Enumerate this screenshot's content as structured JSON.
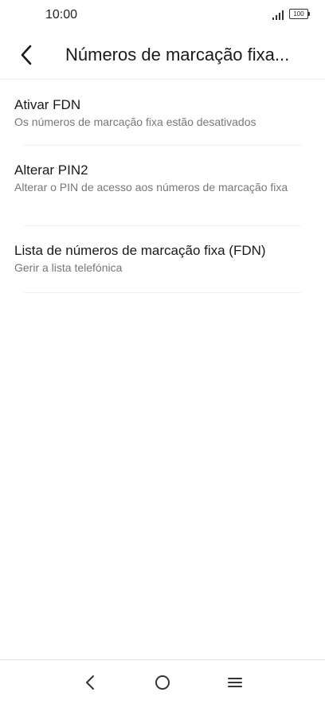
{
  "status_bar": {
    "time": "10:00",
    "battery": "100",
    "icons": [
      "signal-icon",
      "battery-icon"
    ]
  },
  "header": {
    "back_icon": "chevron-left-icon",
    "title": "Números de marcação fixa..."
  },
  "items": [
    {
      "title": "Ativar FDN",
      "subtitle": "Os números de marcação fixa estão desativados"
    },
    {
      "title": "Alterar PIN2",
      "subtitle": "Alterar o PIN de acesso aos números de marcação fixa"
    },
    {
      "title": "Lista de números de marcação fixa (FDN)",
      "subtitle": "Gerir a lista telefónica"
    }
  ],
  "nav_bar": {
    "icons": [
      "back-triangle-icon",
      "home-circle-icon",
      "menu-lines-icon"
    ]
  },
  "colors": {
    "background": "#ffffff",
    "text_primary": "#1a1a1a",
    "text_secondary": "#777777",
    "divider": "#f1f1f1"
  }
}
